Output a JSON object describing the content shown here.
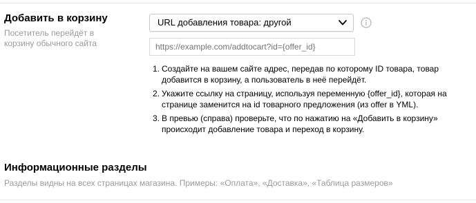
{
  "add_to_cart": {
    "title": "Добавить в корзину",
    "description": "Посетитель перейдёт в корзину обычного сайта",
    "select_value": "URL добавления товара: другой",
    "url_placeholder": "https://example.com/addtocart?id={offer_id}",
    "steps": [
      {
        "num": "1.",
        "text": "Создайте на вашем сайте адрес, передав по которому ID товара, товар добавится в корзину, а пользователь в неё перейдёт."
      },
      {
        "num": "2.",
        "text": "Укажите ссылку на страницу, используя переменную {offer_id}, которая на странице заменится на id товарного предложения (из offer в YML)."
      },
      {
        "num": "3.",
        "text": "В превью (справа) проверьте, что по нажатию на «Добавить в корзину» происходит добавление товара и переход в корзину."
      }
    ]
  },
  "info_sections": {
    "title": "Информационные разделы",
    "description": "Разделы видны на всех страницах магазина. Примеры: «Оплата», «Доставка», «Таблица размеров»"
  },
  "icons": {
    "dropdown": "chevron-down-icon",
    "info": "info-icon"
  },
  "colors": {
    "muted_text": "#9a9a9a",
    "border": "#c8c8c8",
    "divider": "#e6e6e6"
  }
}
